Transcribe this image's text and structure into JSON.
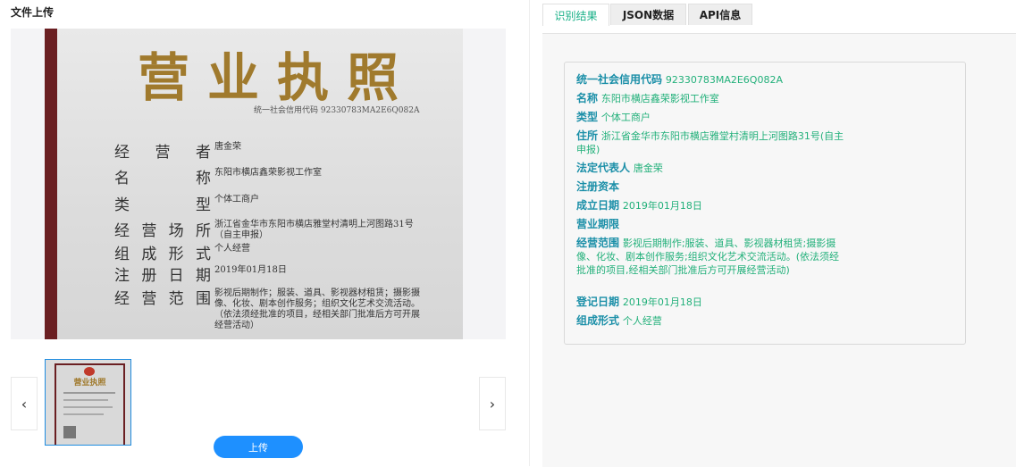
{
  "left": {
    "title": "文件上传",
    "license": {
      "heading": "营业执照",
      "code_line": "统一社会信用代码 92330783MA2E6Q082A",
      "rows": [
        {
          "label": "经营者",
          "value": "唐金荣"
        },
        {
          "label": "名称",
          "value": "东阳市横店鑫荣影视工作室"
        },
        {
          "label": "类型",
          "value": "个体工商户"
        },
        {
          "label": "经营场所",
          "value": "浙江省金华市东阳市横店雅堂村清明上河图路31号（自主申报）"
        },
        {
          "label": "组成形式",
          "value": "个人经营"
        },
        {
          "label": "注册日期",
          "value": "2019年01月18日"
        },
        {
          "label": "经营范围",
          "value": "影视后期制作；服装、道具、影视器材租赁；摄影摄像、化妆、剧本创作服务；组织文化艺术交流活动。（依法须经批准的项目，经相关部门批准后方可开展经营活动）"
        }
      ]
    },
    "thumbnail_title": "营业执照",
    "prev_icon": "‹",
    "next_icon": "›",
    "upload_label": "上传"
  },
  "tabs": [
    {
      "label": "识别结果",
      "active": true
    },
    {
      "label": "JSON数据",
      "active": false
    },
    {
      "label": "API信息",
      "active": false
    }
  ],
  "result": {
    "fields": [
      {
        "key": "统一社会信用代码",
        "value": "92330783MA2E6Q082A"
      },
      {
        "key": "名称",
        "value": "东阳市横店鑫荣影视工作室"
      },
      {
        "key": "类型",
        "value": "个体工商户"
      },
      {
        "key": "住所",
        "value": "浙江省金华市东阳市横店雅堂村清明上河图路31号(自主申报)"
      },
      {
        "key": "法定代表人",
        "value": "唐金荣"
      },
      {
        "key": "注册资本",
        "value": ""
      },
      {
        "key": "成立日期",
        "value": "2019年01月18日"
      },
      {
        "key": "营业期限",
        "value": ""
      },
      {
        "key": "经营范围",
        "value": "影视后期制作;服装、道具、影视器材租赁;摄影摄像、化妆、剧本创作服务;组织文化艺术交流活动。(依法须经批准的项目,经相关部门批准后方可开展经营活动)"
      },
      {
        "key": "登记日期",
        "value": "2019年01月18日"
      },
      {
        "key": "组成形式",
        "value": "个人经营"
      }
    ]
  },
  "colors": {
    "accent": "#18b087",
    "primary_button": "#1e90ff",
    "key_text": "#1b8fa8"
  }
}
